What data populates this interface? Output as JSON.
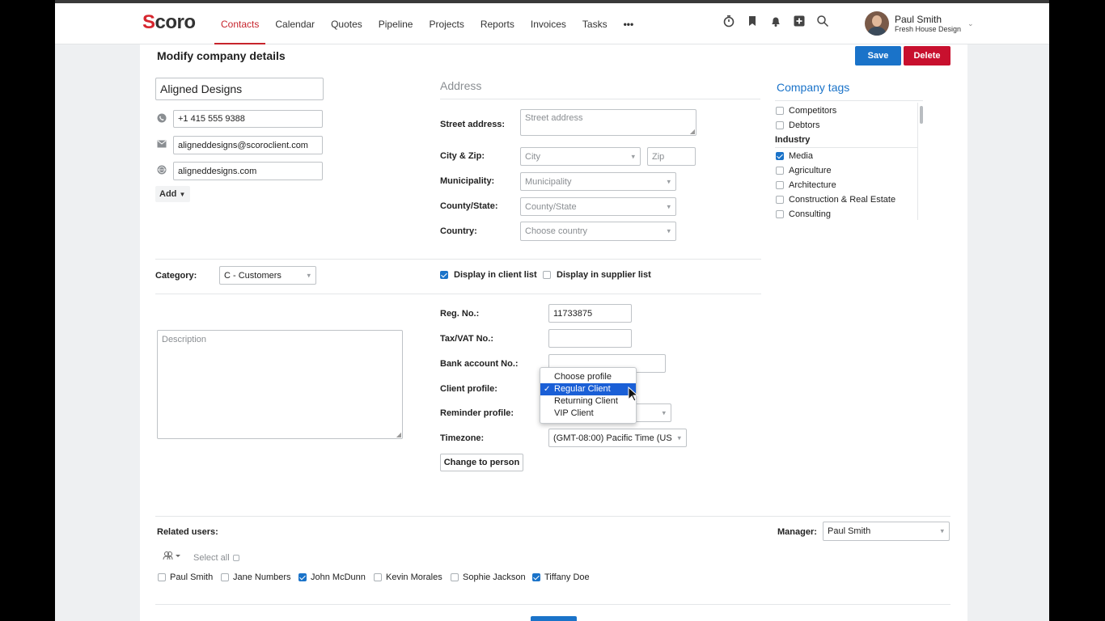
{
  "app": {
    "logo": "Scoro"
  },
  "nav": [
    "Contacts",
    "Calendar",
    "Quotes",
    "Pipeline",
    "Projects",
    "Reports",
    "Invoices",
    "Tasks"
  ],
  "more_label": "•••",
  "user": {
    "name": "Paul Smith",
    "company": "Fresh House Design"
  },
  "page": {
    "title": "Modify company details",
    "save": "Save",
    "delete": "Delete"
  },
  "company": {
    "name": "Aligned Designs",
    "phone": "+1 415 555 9388",
    "email": "aligneddesigns@scoroclient.com",
    "website": "aligneddesigns.com",
    "add_label": "Add"
  },
  "address": {
    "title": "Address",
    "street_label": "Street address:",
    "street_placeholder": "Street address",
    "cityzip_label": "City & Zip:",
    "city_placeholder": "City",
    "zip_placeholder": "Zip",
    "municipality_label": "Municipality:",
    "municipality_placeholder": "Municipality",
    "county_label": "County/State:",
    "county_placeholder": "County/State",
    "country_label": "Country:",
    "country_placeholder": "Choose country"
  },
  "tags": {
    "title": "Company tags",
    "general": [
      {
        "label": "Competitors",
        "checked": false
      },
      {
        "label": "Debtors",
        "checked": false
      }
    ],
    "industry_label": "Industry",
    "industry": [
      {
        "label": "Media",
        "checked": true
      },
      {
        "label": "Agriculture",
        "checked": false
      },
      {
        "label": "Architecture",
        "checked": false
      },
      {
        "label": "Construction & Real Estate",
        "checked": false
      },
      {
        "label": "Consulting",
        "checked": false
      }
    ]
  },
  "category": {
    "label": "Category:",
    "value": "C - Customers"
  },
  "lists": {
    "client_label": "Display in client list",
    "client_checked": true,
    "supplier_label": "Display in supplier list",
    "supplier_checked": false
  },
  "description_placeholder": "Description",
  "details": {
    "reg_label": "Reg. No.:",
    "reg_value": "11733875",
    "tax_label": "Tax/VAT No.:",
    "bank_label": "Bank account No.:",
    "client_profile_label": "Client profile:",
    "reminder_label": "Reminder profile:",
    "timezone_label": "Timezone:",
    "timezone_value": "(GMT-08:00) Pacific Time (US"
  },
  "profile_options": [
    {
      "label": "Choose profile",
      "selected": false
    },
    {
      "label": "Regular Client",
      "selected": true
    },
    {
      "label": "Returning Client",
      "selected": false
    },
    {
      "label": "VIP Client",
      "selected": false
    }
  ],
  "change_to_person": "Change to person",
  "related": {
    "label": "Related users:",
    "select_all": "Select all",
    "manager_label": "Manager:",
    "manager_value": "Paul Smith",
    "users": [
      {
        "name": "Paul Smith",
        "checked": false
      },
      {
        "name": "Jane Numbers",
        "checked": false
      },
      {
        "name": "John McDunn",
        "checked": true
      },
      {
        "name": "Kevin Morales",
        "checked": false
      },
      {
        "name": "Sophie Jackson",
        "checked": false
      },
      {
        "name": "Tiffany Doe",
        "checked": true
      }
    ]
  },
  "colors": {
    "accent": "#1a73c9",
    "danger": "#c8102e",
    "nav_active": "#c7242c",
    "highlight": "#1a5fd6"
  }
}
